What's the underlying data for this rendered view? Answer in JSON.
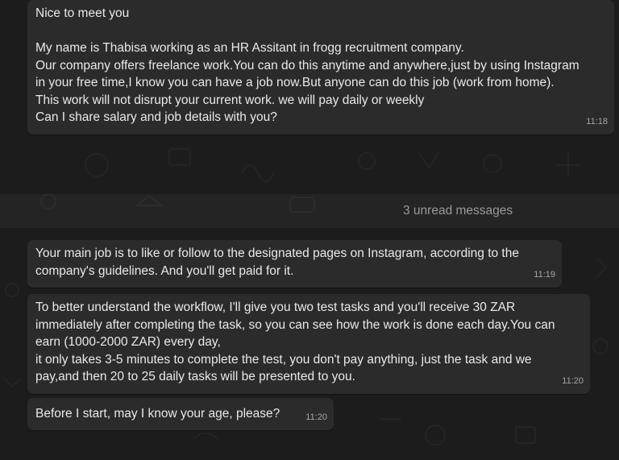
{
  "messages": [
    {
      "text": "Nice to meet you\n\nMy name is Thabisa working as an HR Assitant in frogg recruitment company.\nOur company offers freelance work.You can do this anytime and anywhere,just by using Instagram\nin your free time,I know you can have a job now.But anyone can do this job (work from home).\nThis work will not disrupt your current work. we will pay daily or weekly\nCan I share salary and job details with you?",
      "time": "11:18"
    },
    {
      "text": "Your main job is to like or follow to the designated pages on Instagram, according to the\ncompany's guidelines. And you'll get paid for it.",
      "time": "11:19"
    },
    {
      "text": "To better understand the workflow, I'll give you two test tasks and you'll receive 30 ZAR\nimmediately after completing the task, so you can see how the work is done each day.You can\nearn (1000-2000 ZAR) every day,\n it only takes 3-5 minutes to complete the test, you don't pay anything, just the task and we\npay,and then 20 to 25 daily tasks will be presented to you.",
      "time": "11:20"
    },
    {
      "text": "Before I start, may I know your age, please?",
      "time": "11:20"
    }
  ],
  "unread_divider": "3 unread messages",
  "colors": {
    "background": "#1c1c1c",
    "bubble": "#2b2b2b",
    "text": "#e9e9e9",
    "timestamp": "#a5a5a5"
  }
}
